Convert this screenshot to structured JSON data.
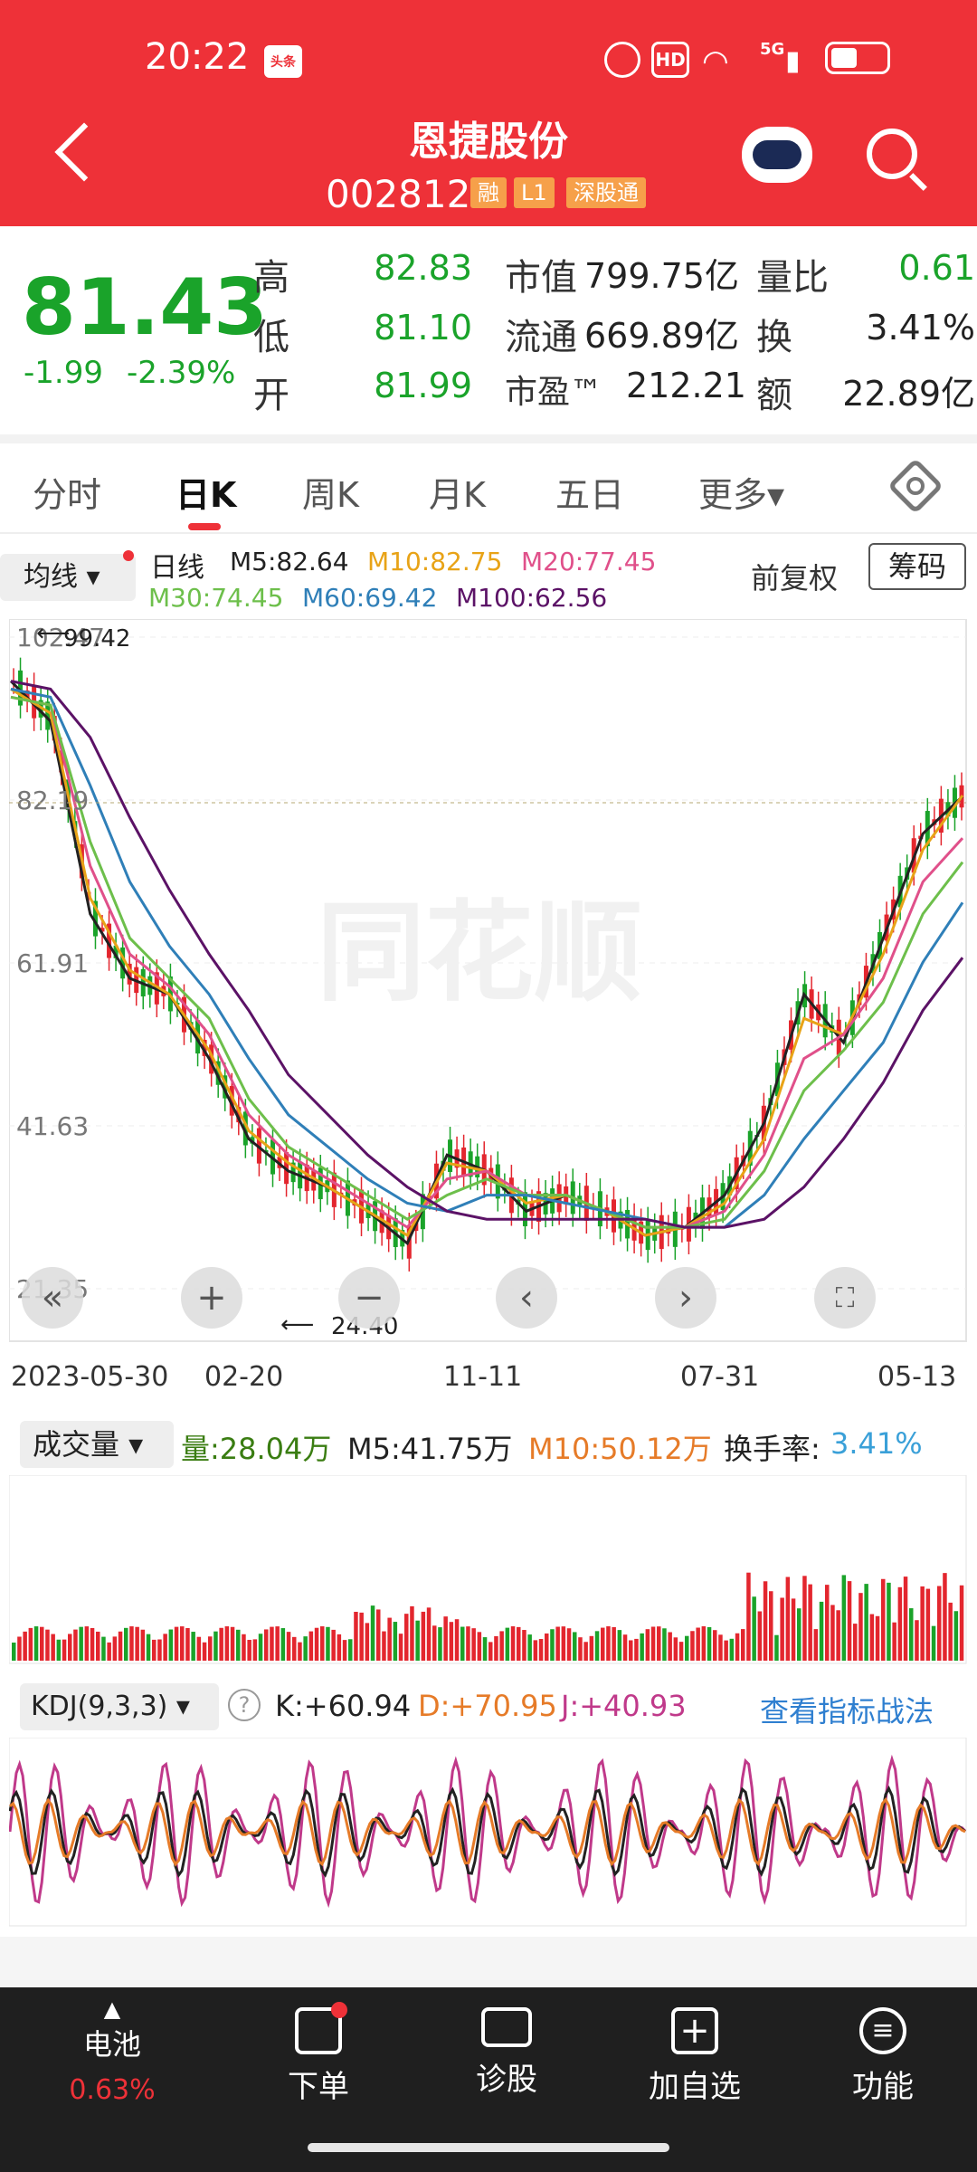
{
  "status": {
    "time": "20:22",
    "toutiao": "头条",
    "hd": "HD",
    "net": "5G"
  },
  "stock": {
    "name": "恩捷股份",
    "code": "002812",
    "tags": [
      "融",
      "L1",
      "深股通"
    ]
  },
  "quote": {
    "price": "81.43",
    "change": "-1.99",
    "change_pct": "-2.39%",
    "high_label": "高",
    "high": "82.83",
    "low_label": "低",
    "low": "81.10",
    "open_label": "开",
    "open": "81.99",
    "mktcap_label": "市值",
    "mktcap": "799.75亿",
    "float_label": "流通",
    "float": "669.89亿",
    "pe_label": "市盈™",
    "pe": "212.21",
    "volratio_label": "量比",
    "volratio": "0.61",
    "turnover_label": "换",
    "turnover": "3.41%",
    "amount_label": "额",
    "amount": "22.89亿"
  },
  "tabs": [
    "分时",
    "日K",
    "周K",
    "月K",
    "五日",
    "更多▾"
  ],
  "ma": {
    "dropdown": "均线 ▾",
    "period": "日线",
    "m5": "M5:82.64",
    "m10": "M10:82.75",
    "m20": "M20:77.45",
    "m30": "M30:74.45",
    "m60": "M60:69.42",
    "m100": "M100:62.56",
    "adjust": "前复权",
    "chips": "筹码"
  },
  "price_axis": [
    "102.47",
    "82.19",
    "61.91",
    "41.63",
    "21.35"
  ],
  "annotations": {
    "high_mark": "99.42",
    "low_mark": "24.40"
  },
  "dates": [
    "2023-05-30",
    "02-20",
    "11-11",
    "07-31",
    "05-13"
  ],
  "volume": {
    "dropdown": "成交量 ▾",
    "vol": "量:28.04万",
    "m5": "M5:41.75万",
    "m10": "M10:50.12万",
    "turnover_label": "换手率:",
    "turnover": "3.41%"
  },
  "kdj": {
    "dropdown": "KDJ(9,3,3) ▾",
    "help": "?",
    "k": "K:+60.94",
    "d": "D:+70.95",
    "j": "J:+40.93",
    "link": "查看指标战法"
  },
  "nav": {
    "battery": "电池",
    "battery_val": "0.63%",
    "order": "下单",
    "diagnose": "诊股",
    "add": "加自选",
    "func": "功能"
  },
  "watermark": "同花顺",
  "colors": {
    "red": "#ee3138",
    "green": "#1aa32a",
    "ma5": "#222222",
    "ma10": "#e8a317",
    "ma20": "#e0508a",
    "ma30": "#6dbf4b",
    "ma60": "#2f7fb8",
    "ma100": "#5b1266",
    "link": "#2f7fd0"
  },
  "chart_data": {
    "type": "line",
    "title": "",
    "series": [
      {
        "name": "M5",
        "values": [
          97,
          92,
          68,
          60,
          58,
          50,
          40,
          36,
          34,
          31,
          27,
          38,
          36,
          31,
          33,
          31,
          28,
          29,
          33,
          42,
          58,
          52,
          65,
          78,
          82.64
        ]
      },
      {
        "name": "M10",
        "values": [
          96,
          93,
          70,
          61,
          58,
          51,
          41,
          37,
          34,
          31,
          28,
          37,
          36,
          32,
          33,
          31,
          28,
          29,
          32,
          40,
          55,
          53,
          63,
          76,
          82.75
        ]
      },
      {
        "name": "M20",
        "values": [
          95,
          94,
          74,
          63,
          59,
          53,
          43,
          38,
          35,
          32,
          29,
          35,
          36,
          33,
          33,
          31,
          29,
          29,
          31,
          38,
          50,
          53,
          60,
          72,
          77.45
        ]
      },
      {
        "name": "M30",
        "values": [
          95,
          94,
          77,
          65,
          60,
          55,
          45,
          39,
          36,
          33,
          30,
          33,
          35,
          33,
          33,
          31,
          29,
          29,
          30,
          36,
          46,
          51,
          57,
          68,
          74.45
        ]
      },
      {
        "name": "M60",
        "values": [
          96,
          95,
          84,
          72,
          64,
          58,
          50,
          43,
          39,
          35,
          32,
          31,
          33,
          33,
          32,
          31,
          30,
          29,
          29,
          33,
          40,
          46,
          52,
          62,
          69.42
        ]
      },
      {
        "name": "M100",
        "values": [
          97,
          96,
          90,
          80,
          71,
          63,
          56,
          48,
          43,
          38,
          34,
          31,
          30,
          30,
          30,
          30,
          30,
          29,
          29,
          30,
          34,
          40,
          47,
          56,
          62.56
        ]
      }
    ],
    "ylim": [
      21.35,
      102.47
    ]
  }
}
